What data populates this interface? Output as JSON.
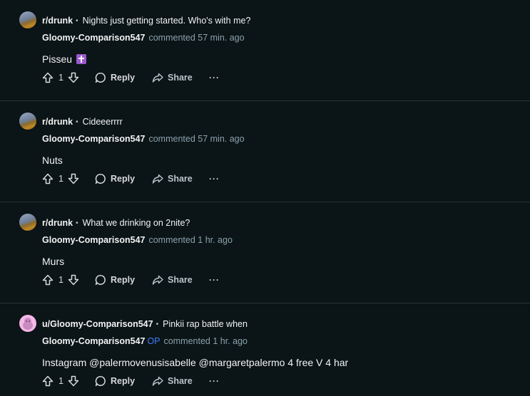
{
  "comments": [
    {
      "context": "r/drunk",
      "avatar": "subreddit-avatar",
      "post_title": "Nights just getting started. Who's with me?",
      "author": "Gloomy-Comparison547",
      "op_badge": "",
      "meta": "commented 57 min. ago",
      "body": "Pisseu",
      "has_emoji": true,
      "emoji": "latin-cross-emoji",
      "votes": "1",
      "reply_label": "Reply",
      "share_label": "Share",
      "more_label": "···"
    },
    {
      "context": "r/drunk",
      "avatar": "subreddit-avatar",
      "post_title": "Cideeerrrr",
      "author": "Gloomy-Comparison547",
      "op_badge": "",
      "meta": "commented 57 min. ago",
      "body": "Nuts",
      "has_emoji": false,
      "votes": "1",
      "reply_label": "Reply",
      "share_label": "Share",
      "more_label": "···"
    },
    {
      "context": "r/drunk",
      "avatar": "subreddit-avatar",
      "post_title": "What we drinking on 2nite?",
      "author": "Gloomy-Comparison547",
      "op_badge": "",
      "meta": "commented 1 hr. ago",
      "body": "Murs",
      "has_emoji": false,
      "votes": "1",
      "reply_label": "Reply",
      "share_label": "Share",
      "more_label": "···"
    },
    {
      "context": "u/Gloomy-Comparison547",
      "avatar": "user-avatar",
      "post_title": "Pinkii rap battle when",
      "author": "Gloomy-Comparison547",
      "op_badge": "OP",
      "meta": "commented 1 hr. ago",
      "body": "Instagram @palermovenusisabelle @margaretpalermo 4 free V 4 har",
      "has_emoji": false,
      "votes": "1",
      "reply_label": "Reply",
      "share_label": "Share",
      "more_label": "···"
    }
  ],
  "colors": {
    "background": "#0b1416",
    "divider": "#2a3236",
    "op_badge": "#3d7eff",
    "meta_text": "#8ba2ad"
  }
}
